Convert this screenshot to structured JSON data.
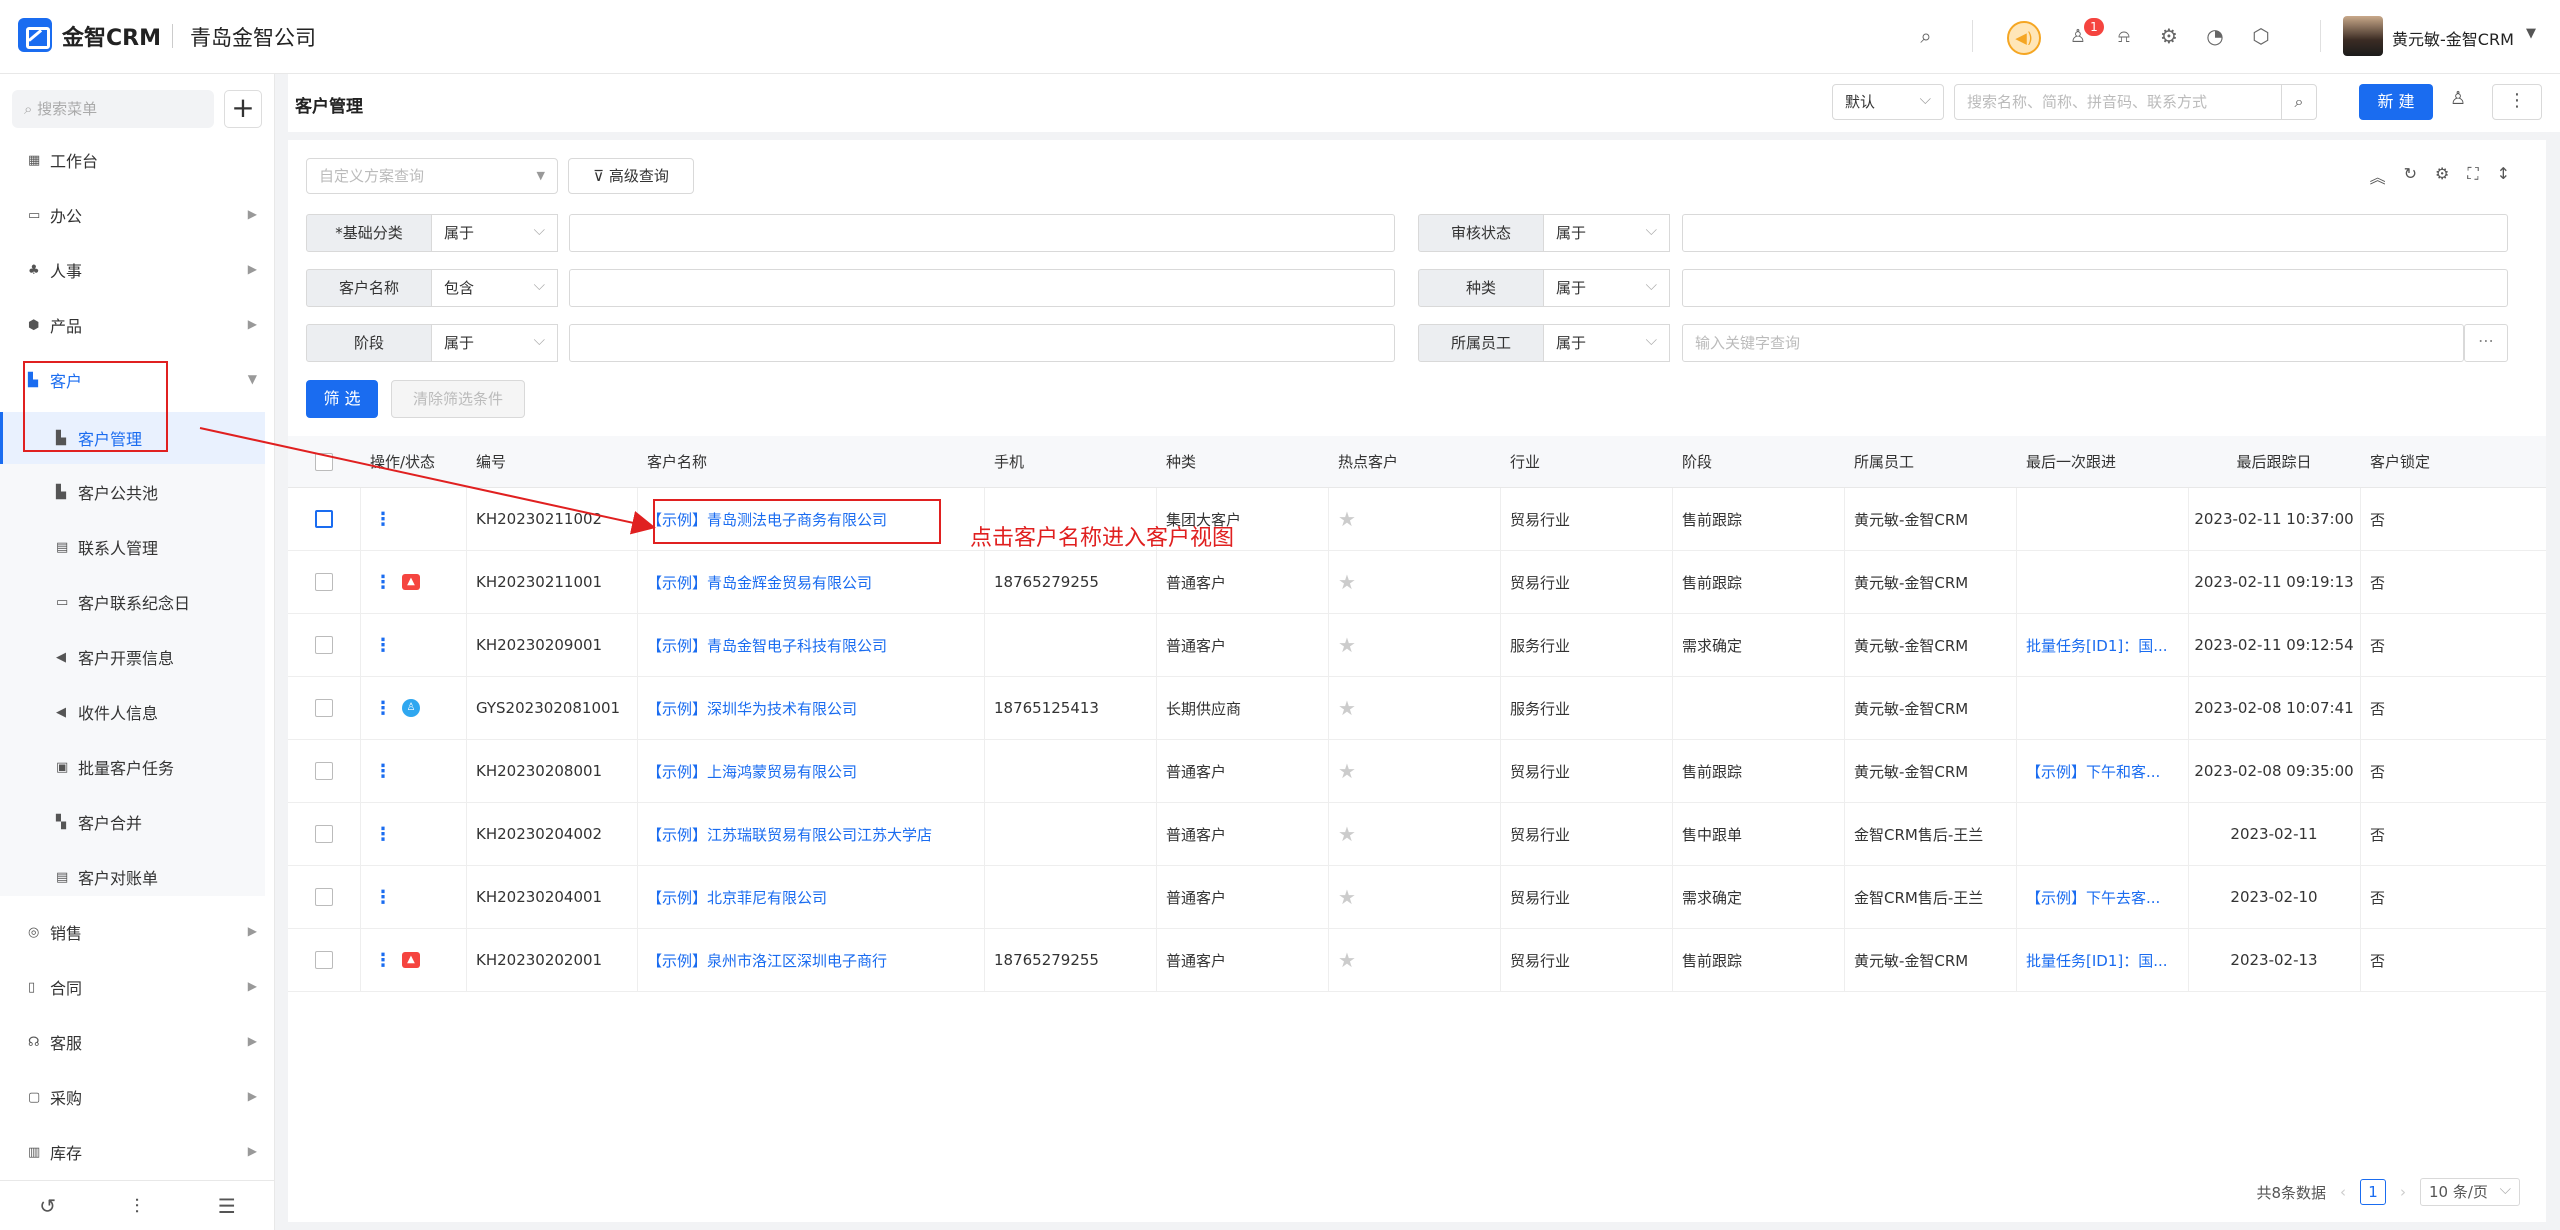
{
  "app": {
    "logo_text": "金智CRM",
    "company": "青岛金智公司"
  },
  "topbar": {
    "badge_count": "1",
    "user_name": "黄元敏-金智CRM"
  },
  "sidebar": {
    "search_placeholder": "搜索菜单",
    "items": [
      {
        "label": "工作台",
        "icon": "dashboard-icon"
      },
      {
        "label": "办公",
        "icon": "office-icon"
      },
      {
        "label": "人事",
        "icon": "people-icon"
      },
      {
        "label": "产品",
        "icon": "product-icon"
      },
      {
        "label": "客户",
        "icon": "customer-icon"
      }
    ],
    "sub_items": [
      "客户管理",
      "客户公共池",
      "联系人管理",
      "客户联系纪念日",
      "客户开票信息",
      "收件人信息",
      "批量客户任务",
      "客户合并",
      "客户对账单"
    ],
    "items_after": [
      "销售",
      "合同",
      "客服",
      "采购",
      "库存"
    ]
  },
  "header": {
    "title": "客户管理",
    "view_select": "默认",
    "search_placeholder": "搜索名称、简称、拼音码、联系方式",
    "new_label": "新 建"
  },
  "filters": {
    "custom_query_placeholder": "自定义方案查询",
    "advanced_label": "高级查询",
    "rows": [
      {
        "label": "*基础分类",
        "op": "属于",
        "value": ""
      },
      {
        "label": "客户名称",
        "op": "包含",
        "value": ""
      },
      {
        "label": "阶段",
        "op": "属于",
        "value": ""
      }
    ],
    "rows_right": [
      {
        "label": "审核状态",
        "op": "属于",
        "value": ""
      },
      {
        "label": "种类",
        "op": "属于",
        "value": ""
      },
      {
        "label": "所属员工",
        "op": "属于",
        "value": "输入关键字查询"
      }
    ],
    "filter_btn": "筛 选",
    "clear_btn": "清除筛选条件"
  },
  "table": {
    "columns": [
      "操作/状态",
      "编号",
      "客户名称",
      "手机",
      "种类",
      "热点客户",
      "行业",
      "阶段",
      "所属员工",
      "最后一次跟进",
      "最后跟踪日",
      "客户锁定"
    ],
    "rows": [
      {
        "status": "",
        "code": "KH20230211002",
        "name": "【示例】青岛测法电子商务有限公司",
        "phone": "",
        "kind": "集团大客户",
        "industry": "贸易行业",
        "stage": "售前跟踪",
        "owner": "黄元敏-金智CRM",
        "last": "",
        "date": "2023-02-11 10:37:00",
        "lock": "否"
      },
      {
        "status": "red",
        "code": "KH20230211001",
        "name": "【示例】青岛金辉金贸易有限公司",
        "phone": "18765279255",
        "kind": "普通客户",
        "industry": "贸易行业",
        "stage": "售前跟踪",
        "owner": "黄元敏-金智CRM",
        "last": "",
        "date": "2023-02-11 09:19:13",
        "lock": "否"
      },
      {
        "status": "",
        "code": "KH20230209001",
        "name": "【示例】青岛金智电子科技有限公司",
        "phone": "",
        "kind": "普通客户",
        "industry": "服务行业",
        "stage": "需求确定",
        "owner": "黄元敏-金智CRM",
        "last": "批量任务[ID1]：国...",
        "date": "2023-02-11 09:12:54",
        "lock": "否"
      },
      {
        "status": "blue",
        "code": "GYS202302081001",
        "name": "【示例】深圳华为技术有限公司",
        "phone": "18765125413",
        "kind": "长期供应商",
        "industry": "服务行业",
        "stage": "",
        "owner": "黄元敏-金智CRM",
        "last": "",
        "date": "2023-02-08 10:07:41",
        "lock": "否"
      },
      {
        "status": "",
        "code": "KH20230208001",
        "name": "【示例】上海鸿蒙贸易有限公司",
        "phone": "",
        "kind": "普通客户",
        "industry": "贸易行业",
        "stage": "售前跟踪",
        "owner": "黄元敏-金智CRM",
        "last": "【示例】下午和客...",
        "date": "2023-02-08 09:35:00",
        "lock": "否"
      },
      {
        "status": "",
        "code": "KH20230204002",
        "name": "【示例】江苏瑞联贸易有限公司江苏大学店",
        "phone": "",
        "kind": "普通客户",
        "industry": "贸易行业",
        "stage": "售中跟单",
        "owner": "金智CRM售后-王兰",
        "last": "",
        "date": "2023-02-11",
        "lock": "否"
      },
      {
        "status": "",
        "code": "KH20230204001",
        "name": "【示例】北京菲尼有限公司",
        "phone": "",
        "kind": "普通客户",
        "industry": "贸易行业",
        "stage": "需求确定",
        "owner": "金智CRM售后-王兰",
        "last": "【示例】下午去客...",
        "date": "2023-02-10",
        "lock": "否"
      },
      {
        "status": "red",
        "code": "KH20230202001",
        "name": "【示例】泉州市洛江区深圳电子商行",
        "phone": "18765279255",
        "kind": "普通客户",
        "industry": "贸易行业",
        "stage": "售前跟踪",
        "owner": "黄元敏-金智CRM",
        "last": "批量任务[ID1]：国...",
        "date": "2023-02-13",
        "lock": "否"
      }
    ]
  },
  "annotation": "点击客户名称进入客户视图",
  "pager": {
    "total": "共8条数据",
    "page": "1",
    "size": "10 条/页"
  }
}
